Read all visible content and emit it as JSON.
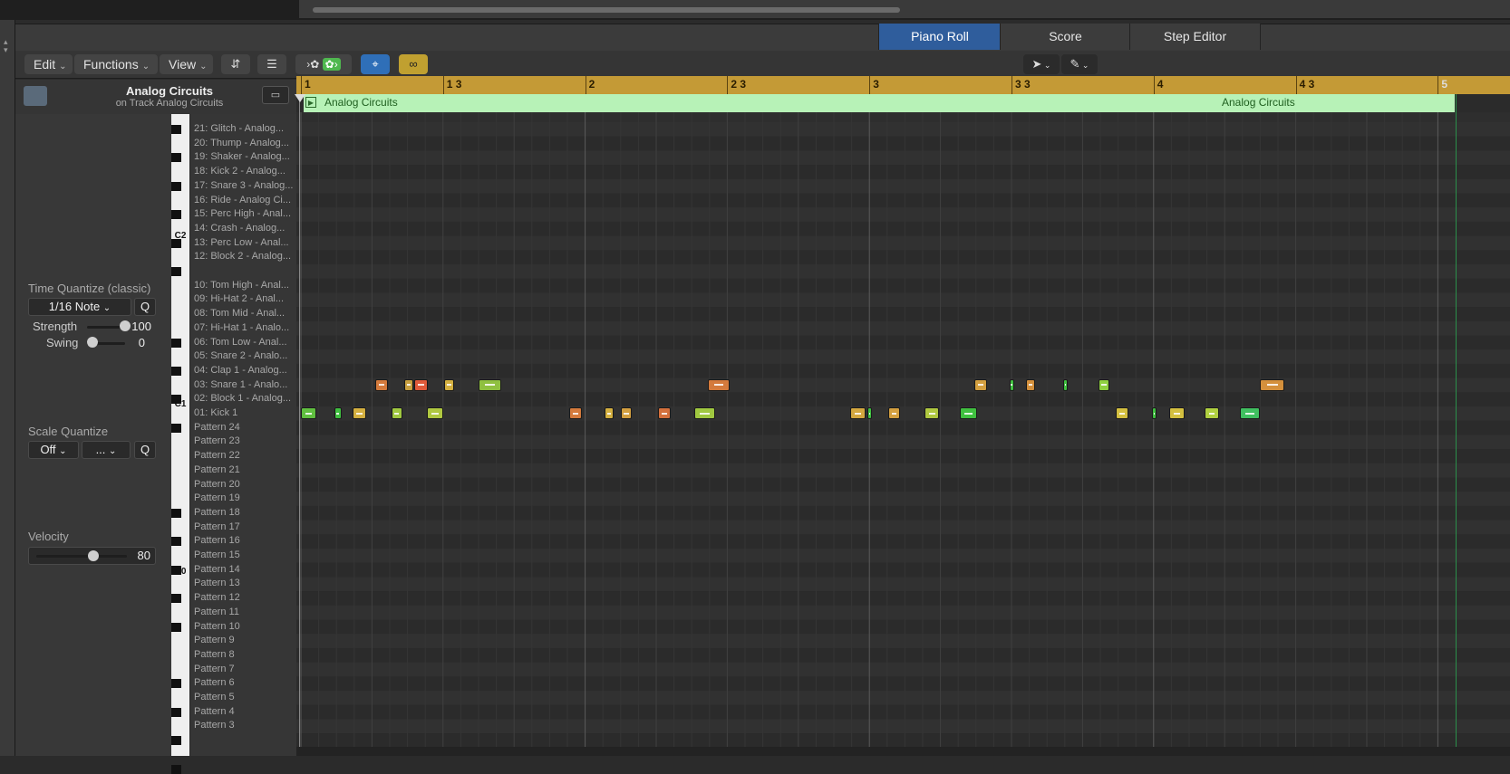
{
  "tabs": [
    {
      "label": "Piano Roll",
      "active": true
    },
    {
      "label": "Score",
      "active": false
    },
    {
      "label": "Step Editor",
      "active": false
    }
  ],
  "menus": {
    "edit": "Edit",
    "functions": "Functions",
    "view": "View"
  },
  "region_header": {
    "title": "Analog Circuits",
    "subtitle": "on Track Analog Circuits"
  },
  "inspector": {
    "time_quantize_label": "Time Quantize (classic)",
    "quantize_value": "1/16 Note",
    "q_button": "Q",
    "strength_label": "Strength",
    "strength_value": "100",
    "strength_level": 1.0,
    "swing_label": "Swing",
    "swing_value": "0",
    "swing_level": 0.0,
    "scale_quantize_label": "Scale Quantize",
    "scale_off": "Off",
    "scale_dots": "...",
    "velocity_label": "Velocity",
    "velocity_value": "80",
    "velocity_level": 0.63
  },
  "octave_labels": [
    "C2",
    "C1",
    "C0"
  ],
  "note_names": [
    "21: Glitch - Analog...",
    "20: Thump - Analog...",
    "19: Shaker - Analog...",
    "18: Kick 2 - Analog...",
    "17: Snare 3 - Analog...",
    "16: Ride - Analog Ci...",
    "15: Perc High - Anal...",
    "14: Crash - Analog...",
    "13: Perc Low - Anal...",
    "12: Block 2 - Analog...",
    "",
    "10: Tom High - Anal...",
    "09: Hi-Hat 2 - Anal...",
    "08: Tom Mid - Anal...",
    "07: Hi-Hat 1 - Analo...",
    "06: Tom Low - Anal...",
    "05: Snare 2 - Analo...",
    "04: Clap 1 - Analog...",
    "03: Snare 1 - Analo...",
    "02: Block 1 - Analog...",
    "01: Kick 1",
    "Pattern 24",
    "Pattern 23",
    "Pattern 22",
    "Pattern 21",
    "Pattern 20",
    "Pattern 19",
    "Pattern 18",
    "Pattern 17",
    "Pattern 16",
    "Pattern 15",
    "Pattern 14",
    "Pattern 13",
    "Pattern 12",
    "Pattern 11",
    "Pattern 10",
    "Pattern  9",
    "Pattern  8",
    "Pattern  7",
    "Pattern  6",
    "Pattern  5",
    "Pattern  4",
    "Pattern  3"
  ],
  "ruler": [
    {
      "label": "1",
      "beat": 0
    },
    {
      "label": "1 3",
      "beat": 2
    },
    {
      "label": "2",
      "beat": 4
    },
    {
      "label": "2 3",
      "beat": 6
    },
    {
      "label": "3",
      "beat": 8
    },
    {
      "label": "3 3",
      "beat": 10
    },
    {
      "label": "4",
      "beat": 12
    },
    {
      "label": "4 3",
      "beat": 14
    },
    {
      "label": "5",
      "beat": 16
    }
  ],
  "region": {
    "name": "Analog Circuits",
    "name_repeat": "Analog Circuits"
  },
  "notes": [
    {
      "row": 18,
      "start": 1.05,
      "len": 0.18,
      "color": "#d47a3c"
    },
    {
      "row": 18,
      "start": 1.45,
      "len": 0.13,
      "color": "#c8a040"
    },
    {
      "row": 18,
      "start": 1.6,
      "len": 0.18,
      "color": "#e05a3a"
    },
    {
      "row": 18,
      "start": 2.02,
      "len": 0.13,
      "color": "#d4b040"
    },
    {
      "row": 18,
      "start": 2.5,
      "len": 0.32,
      "color": "#8fc040"
    },
    {
      "row": 18,
      "start": 5.73,
      "len": 0.3,
      "color": "#d47a3c"
    },
    {
      "row": 18,
      "start": 9.48,
      "len": 0.18,
      "color": "#d4a040"
    },
    {
      "row": 18,
      "start": 9.97,
      "len": 0.05,
      "color": "#40c040"
    },
    {
      "row": 18,
      "start": 10.2,
      "len": 0.13,
      "color": "#d4903c"
    },
    {
      "row": 18,
      "start": 10.73,
      "len": 0.05,
      "color": "#40c040"
    },
    {
      "row": 18,
      "start": 11.22,
      "len": 0.16,
      "color": "#8fd040"
    },
    {
      "row": 18,
      "start": 13.5,
      "len": 0.34,
      "color": "#d4903c"
    },
    {
      "row": 20,
      "start": 0.0,
      "len": 0.22,
      "color": "#60c040"
    },
    {
      "row": 20,
      "start": 0.47,
      "len": 0.1,
      "color": "#40c040"
    },
    {
      "row": 20,
      "start": 0.73,
      "len": 0.19,
      "color": "#d4b040"
    },
    {
      "row": 20,
      "start": 1.27,
      "len": 0.16,
      "color": "#a0c840"
    },
    {
      "row": 20,
      "start": 1.77,
      "len": 0.23,
      "color": "#b0c840"
    },
    {
      "row": 20,
      "start": 3.78,
      "len": 0.18,
      "color": "#d47a3c"
    },
    {
      "row": 20,
      "start": 4.27,
      "len": 0.13,
      "color": "#d4b040"
    },
    {
      "row": 20,
      "start": 4.5,
      "len": 0.16,
      "color": "#d4a040"
    },
    {
      "row": 20,
      "start": 5.03,
      "len": 0.18,
      "color": "#d4703c"
    },
    {
      "row": 20,
      "start": 5.53,
      "len": 0.3,
      "color": "#a0c840"
    },
    {
      "row": 20,
      "start": 7.73,
      "len": 0.22,
      "color": "#d4a840"
    },
    {
      "row": 20,
      "start": 7.97,
      "len": 0.07,
      "color": "#40c040"
    },
    {
      "row": 20,
      "start": 8.27,
      "len": 0.16,
      "color": "#d4a040"
    },
    {
      "row": 20,
      "start": 8.78,
      "len": 0.2,
      "color": "#b0c840"
    },
    {
      "row": 20,
      "start": 9.27,
      "len": 0.25,
      "color": "#40c040"
    },
    {
      "row": 20,
      "start": 11.47,
      "len": 0.18,
      "color": "#d4c040"
    },
    {
      "row": 20,
      "start": 11.98,
      "len": 0.06,
      "color": "#40c040"
    },
    {
      "row": 20,
      "start": 12.22,
      "len": 0.22,
      "color": "#d4c040"
    },
    {
      "row": 20,
      "start": 12.72,
      "len": 0.2,
      "color": "#b0d040"
    },
    {
      "row": 20,
      "start": 13.22,
      "len": 0.28,
      "color": "#40c060"
    }
  ],
  "colors": {
    "ruler": "#c49a36",
    "region": "#b7f2b7",
    "tab_active": "#2f5d9c",
    "grid_bg": "#2e2e2e"
  }
}
